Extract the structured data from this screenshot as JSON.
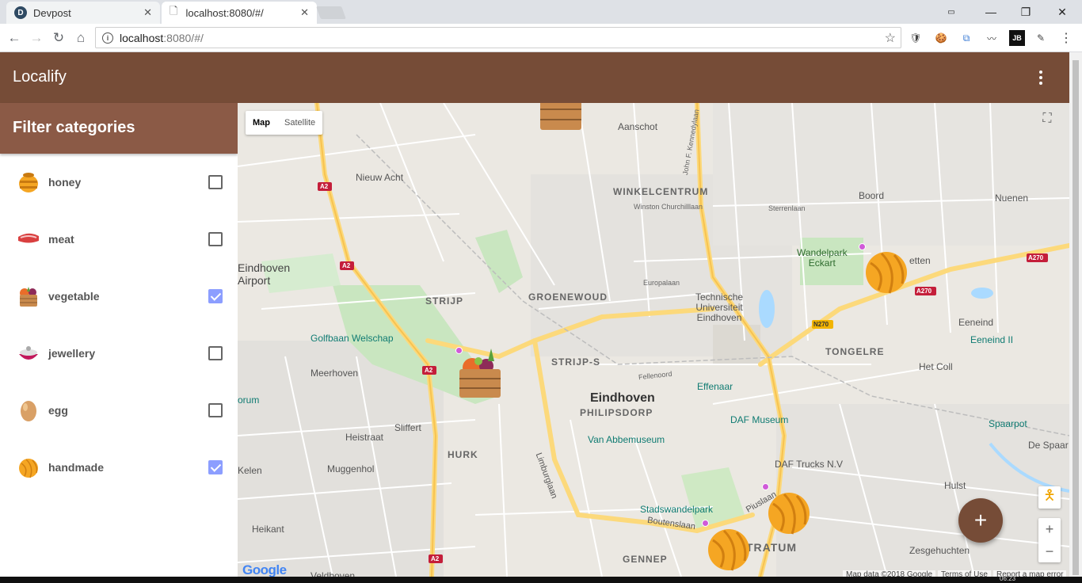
{
  "browser": {
    "tabs": [
      {
        "title": "Devpost",
        "favicon": "D"
      },
      {
        "title": "localhost:8080/#/"
      }
    ],
    "url_host": "localhost",
    "url_path": ":8080/#/"
  },
  "app": {
    "title": "Localify",
    "brand_color": "#764c37"
  },
  "sidebar": {
    "heading": "Filter categories",
    "categories": [
      {
        "label": "honey",
        "icon": "honey-pot-icon",
        "checked": false
      },
      {
        "label": "meat",
        "icon": "steak-icon",
        "checked": false
      },
      {
        "label": "vegetable",
        "icon": "vegetable-crate-icon",
        "checked": true
      },
      {
        "label": "jewellery",
        "icon": "jewellery-icon",
        "checked": false
      },
      {
        "label": "egg",
        "icon": "egg-icon",
        "checked": false
      },
      {
        "label": "handmade",
        "icon": "yarn-ball-icon",
        "checked": true
      }
    ]
  },
  "map": {
    "type_map": "Map",
    "type_satellite": "Satellite",
    "google_logo": "Google",
    "attribution_data": "Map data ©2018 Google",
    "attribution_terms": "Terms of Use",
    "attribution_report": "Report a map error",
    "labels": {
      "aanschot": "Aanschot",
      "nieuw_acht": "Nieuw Acht",
      "winkelcentrum": "WINKELCENTRUM",
      "boord": "Boord",
      "nuenen": "Nuenen",
      "airport": "Eindhoven\nAirport",
      "wandelpark": "Wandelpark\nEckart",
      "etten": "etten",
      "strijp": "STRIJP",
      "groenewoud": "GROENEWOUD",
      "tue": "Technische\nUniversiteit\nEindhoven",
      "eeneind": "Eeneind",
      "eeneind2": "Eeneind II",
      "golfbaan": "Golfbaan Welschap",
      "tongelre": "TONGELRE",
      "meerhoven": "Meerhoven",
      "strijps": "STRIJP-S",
      "hetcoll": "Het Coll",
      "effenaar": "Effenaar",
      "eindhoven": "Eindhoven",
      "philipsdorp": "PHILIPSDORP",
      "daf_museum": "DAF Museum",
      "spaarpot": "Spaarpot",
      "orum": "orum",
      "heistraat": "Heistraat",
      "sliffert": "Sliffert",
      "vanabbe": "Van Abbemuseum",
      "despaar": "De Spaar",
      "hurk": "HURK",
      "daftrucks": "DAF Trucks N.V",
      "kelen": "Kelen",
      "muggenhol": "Muggenhol",
      "hulst": "Hulst",
      "stadswandel": "Stadswandelpark",
      "heikant": "Heikant",
      "stratum": "TRATUM",
      "zesgehuchten": "Zesgehuchten",
      "gennep": "GENNEP",
      "veldhoven": "Veldhoven",
      "limburglaan": "Limburglaan",
      "boutenslaan": "Boutenslaan",
      "piuslaan": "Piuslaan",
      "a2_1": "A2",
      "a2_2": "A2",
      "a2_3": "A2",
      "a2_4": "A2",
      "a270_1": "A270",
      "a270_2": "A270",
      "n270": "N270",
      "john_f": "John F. Kennedylaan",
      "sterrenlaan": "Sterrenlaan",
      "winston": "Winston Churchilllaan",
      "europalaan": "Europalaan",
      "fellenoord": "Fellenoord"
    }
  },
  "fab_label": "+",
  "taskbar_clock": "06:23"
}
